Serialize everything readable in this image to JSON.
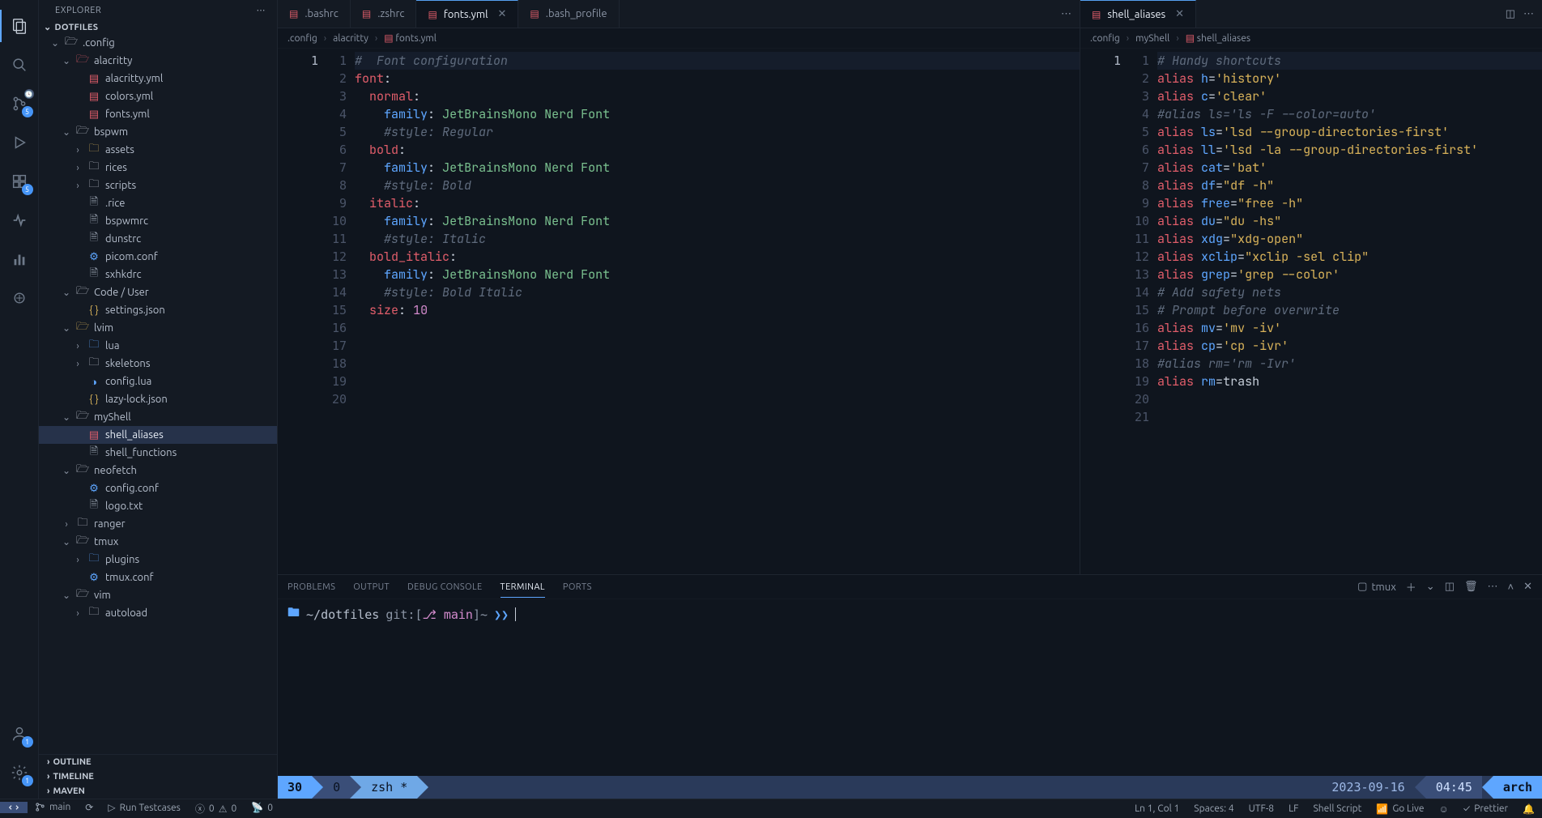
{
  "explorer_label": "EXPLORER",
  "project_name": "DOTFILES",
  "badges": {
    "scm": "5",
    "account": "1",
    "settings": "1"
  },
  "tree": [
    {
      "depth": 0,
      "open": true,
      "type": "folder",
      "name": ".config",
      "tint": "i-folder-open"
    },
    {
      "depth": 1,
      "open": true,
      "type": "folder",
      "name": "alacritty",
      "tint": "i-yml",
      "foldertint": true
    },
    {
      "depth": 2,
      "type": "file",
      "name": "alacritty.yml",
      "tint": "i-yml"
    },
    {
      "depth": 2,
      "type": "file",
      "name": "colors.yml",
      "tint": "i-yml"
    },
    {
      "depth": 2,
      "type": "file",
      "name": "fonts.yml",
      "tint": "i-yml"
    },
    {
      "depth": 1,
      "open": true,
      "type": "folder",
      "name": "bspwm",
      "tint": "i-folder-open"
    },
    {
      "depth": 2,
      "closed": true,
      "type": "folder",
      "name": "assets",
      "tint": "i-yellow"
    },
    {
      "depth": 2,
      "closed": true,
      "type": "folder",
      "name": "rices",
      "tint": "i-folder"
    },
    {
      "depth": 2,
      "closed": true,
      "type": "folder",
      "name": "scripts",
      "tint": "i-folder"
    },
    {
      "depth": 2,
      "type": "file",
      "name": ".rice",
      "tint": "i-file"
    },
    {
      "depth": 2,
      "type": "file",
      "name": "bspwmrc",
      "tint": "i-file"
    },
    {
      "depth": 2,
      "type": "file",
      "name": "dunstrc",
      "tint": "i-file"
    },
    {
      "depth": 2,
      "type": "file",
      "name": "picom.conf",
      "tint": "i-gear"
    },
    {
      "depth": 2,
      "type": "file",
      "name": "sxhkdrc",
      "tint": "i-file"
    },
    {
      "depth": 1,
      "open": true,
      "type": "folder",
      "name": "Code / User",
      "tint": "i-folder-open"
    },
    {
      "depth": 2,
      "type": "file",
      "name": "settings.json",
      "tint": "i-json"
    },
    {
      "depth": 1,
      "open": true,
      "type": "folder",
      "name": "lvim",
      "tint": "i-json",
      "foldertint": true
    },
    {
      "depth": 2,
      "closed": true,
      "type": "folder",
      "name": "lua",
      "tint": "i-folder-blue"
    },
    {
      "depth": 2,
      "closed": true,
      "type": "folder",
      "name": "skeletons",
      "tint": "i-folder"
    },
    {
      "depth": 2,
      "type": "file",
      "name": "config.lua",
      "tint": "i-lua"
    },
    {
      "depth": 2,
      "type": "file",
      "name": "lazy-lock.json",
      "tint": "i-json"
    },
    {
      "depth": 1,
      "open": true,
      "type": "folder",
      "name": "myShell",
      "tint": "i-folder-open"
    },
    {
      "depth": 2,
      "type": "file",
      "name": "shell_aliases",
      "tint": "i-yml",
      "active": true
    },
    {
      "depth": 2,
      "type": "file",
      "name": "shell_functions",
      "tint": "i-file"
    },
    {
      "depth": 1,
      "open": true,
      "type": "folder",
      "name": "neofetch",
      "tint": "i-folder-open"
    },
    {
      "depth": 2,
      "type": "file",
      "name": "config.conf",
      "tint": "i-gear"
    },
    {
      "depth": 2,
      "type": "file",
      "name": "logo.txt",
      "tint": "i-file"
    },
    {
      "depth": 1,
      "closed": true,
      "type": "folder",
      "name": "ranger",
      "tint": "i-folder"
    },
    {
      "depth": 1,
      "open": true,
      "type": "folder",
      "name": "tmux",
      "tint": "i-folder-open"
    },
    {
      "depth": 2,
      "closed": true,
      "type": "folder",
      "name": "plugins",
      "tint": "i-gear"
    },
    {
      "depth": 2,
      "type": "file",
      "name": "tmux.conf",
      "tint": "i-gear"
    },
    {
      "depth": 1,
      "open": true,
      "type": "folder",
      "name": "vim",
      "tint": "i-folder-open"
    },
    {
      "depth": 2,
      "closed": true,
      "type": "folder",
      "name": "autoload",
      "tint": "i-folder"
    }
  ],
  "outline_sections": [
    "OUTLINE",
    "TIMELINE",
    "MAVEN"
  ],
  "tabs_left": [
    {
      "label": ".bashrc",
      "icon": "i-yml"
    },
    {
      "label": ".zshrc",
      "icon": "i-yml"
    },
    {
      "label": "fonts.yml",
      "icon": "i-yml",
      "active": true,
      "dirty": false,
      "close": true
    },
    {
      "label": ".bash_profile",
      "icon": "i-yml"
    }
  ],
  "tabs_right": [
    {
      "label": "shell_aliases",
      "icon": "i-yml",
      "active": true,
      "close": true
    }
  ],
  "breadcrumb_left": [
    ".config",
    "alacritty",
    "fonts.yml"
  ],
  "breadcrumb_right": [
    ".config",
    "myShell",
    "shell_aliases"
  ],
  "code_left": [
    {
      "cls": "comment",
      "text": "#  Font configuration"
    },
    {
      "raw": "<span class='tok-key'>font</span><span class='tok-punc'>:</span>"
    },
    {
      "raw": "  <span class='tok-key'>normal</span><span class='tok-punc'>:</span>"
    },
    {
      "raw": "    <span class='tok-prop'>family</span><span class='tok-punc'>:</span> <span class='tok-str'>JetBrainsMono Nerd Font</span>"
    },
    {
      "cls": "comment",
      "text": "    #style: Regular"
    },
    {
      "raw": ""
    },
    {
      "raw": "  <span class='tok-key'>bold</span><span class='tok-punc'>:</span>"
    },
    {
      "raw": "    <span class='tok-prop'>family</span><span class='tok-punc'>:</span> <span class='tok-str'>JetBrainsMono Nerd Font</span>"
    },
    {
      "cls": "comment",
      "text": "    #style: Bold"
    },
    {
      "raw": ""
    },
    {
      "raw": "  <span class='tok-key'>italic</span><span class='tok-punc'>:</span>"
    },
    {
      "raw": "    <span class='tok-prop'>family</span><span class='tok-punc'>:</span> <span class='tok-str'>JetBrainsMono Nerd Font</span>"
    },
    {
      "cls": "comment",
      "text": "    #style: Italic"
    },
    {
      "raw": ""
    },
    {
      "raw": "  <span class='tok-key'>bold_italic</span><span class='tok-punc'>:</span>"
    },
    {
      "raw": "    <span class='tok-prop'>family</span><span class='tok-punc'>:</span> <span class='tok-str'>JetBrainsMono Nerd Font</span>"
    },
    {
      "cls": "comment",
      "text": "    #style: Bold Italic"
    },
    {
      "raw": ""
    },
    {
      "raw": "  <span class='tok-key'>size</span><span class='tok-punc'>:</span> <span class='tok-num'>10</span>"
    },
    {
      "raw": ""
    }
  ],
  "code_right": [
    {
      "cls": "comment",
      "text": "# Handy shortcuts"
    },
    {
      "raw": "<span class='tok-alias'>alias</span> <span class='tok-name'>h</span><span class='tok-eq'>=</span><span class='tok-str2'>'history'</span>"
    },
    {
      "raw": "<span class='tok-alias'>alias</span> <span class='tok-name'>c</span><span class='tok-eq'>=</span><span class='tok-str2'>'clear'</span>"
    },
    {
      "cls": "comment",
      "text": "#alias ls='ls -F --color=auto'"
    },
    {
      "raw": "<span class='tok-alias'>alias</span> <span class='tok-name'>ls</span><span class='tok-eq'>=</span><span class='tok-str2'>'lsd --group-directories-first'</span>"
    },
    {
      "raw": "<span class='tok-alias'>alias</span> <span class='tok-name'>ll</span><span class='tok-eq'>=</span><span class='tok-str2'>'lsd -la --group-directories-first'</span>"
    },
    {
      "raw": "<span class='tok-alias'>alias</span> <span class='tok-name'>cat</span><span class='tok-eq'>=</span><span class='tok-str2'>'bat'</span>"
    },
    {
      "raw": "<span class='tok-alias'>alias</span> <span class='tok-name'>df</span><span class='tok-eq'>=</span><span class='tok-str2'>\"df -h\"</span>"
    },
    {
      "raw": "<span class='tok-alias'>alias</span> <span class='tok-name'>free</span><span class='tok-eq'>=</span><span class='tok-str2'>\"free -h\"</span>"
    },
    {
      "raw": "<span class='tok-alias'>alias</span> <span class='tok-name'>du</span><span class='tok-eq'>=</span><span class='tok-str2'>\"du -hs\"</span>"
    },
    {
      "raw": "<span class='tok-alias'>alias</span> <span class='tok-name'>xdg</span><span class='tok-eq'>=</span><span class='tok-str2'>\"xdg-open\"</span>"
    },
    {
      "raw": "<span class='tok-alias'>alias</span> <span class='tok-name'>xclip</span><span class='tok-eq'>=</span><span class='tok-str2'>\"xclip -sel clip\"</span>"
    },
    {
      "raw": "<span class='tok-alias'>alias</span> <span class='tok-name'>grep</span><span class='tok-eq'>=</span><span class='tok-str2'>'grep --color'</span>"
    },
    {
      "raw": ""
    },
    {
      "cls": "comment",
      "text": "# Add safety nets"
    },
    {
      "cls": "comment",
      "text": "# Prompt before overwrite"
    },
    {
      "raw": "<span class='tok-alias'>alias</span> <span class='tok-name'>mv</span><span class='tok-eq'>=</span><span class='tok-str2'>'mv -iv'</span>"
    },
    {
      "raw": "<span class='tok-alias'>alias</span> <span class='tok-name'>cp</span><span class='tok-eq'>=</span><span class='tok-str2'>'cp -ivr'</span>"
    },
    {
      "cls": "comment",
      "text": "#alias rm='rm -Ivr'"
    },
    {
      "raw": "<span class='tok-alias'>alias</span> <span class='tok-name'>rm</span><span class='tok-eq'>=</span>trash"
    },
    {
      "raw": ""
    }
  ],
  "panel_tabs": [
    "PROBLEMS",
    "OUTPUT",
    "DEBUG CONSOLE",
    "TERMINAL",
    "PORTS"
  ],
  "panel_active": "TERMINAL",
  "terminal_profile": "tmux",
  "terminal": {
    "cwd": "~/dotfiles",
    "git_prefix": "git:[",
    "branch_icon": "⎇",
    "branch": "main",
    "git_suffix": "]~",
    "prompt": "❯❯"
  },
  "tmux": {
    "session": "30",
    "window": "0",
    "proc": "zsh *",
    "date": "2023-09-16",
    "time": "04:45",
    "host": "arch"
  },
  "status_left": {
    "branch": "main",
    "sync": "⟳",
    "run": "Run Testcases",
    "err": "0",
    "warn": "0",
    "ports": "0"
  },
  "status_right": {
    "pos": "Ln 1, Col 1",
    "spaces": "Spaces: 4",
    "enc": "UTF-8",
    "eol": "LF",
    "lang": "Shell Script",
    "golive": "Go Live",
    "prettier": "Prettier"
  }
}
